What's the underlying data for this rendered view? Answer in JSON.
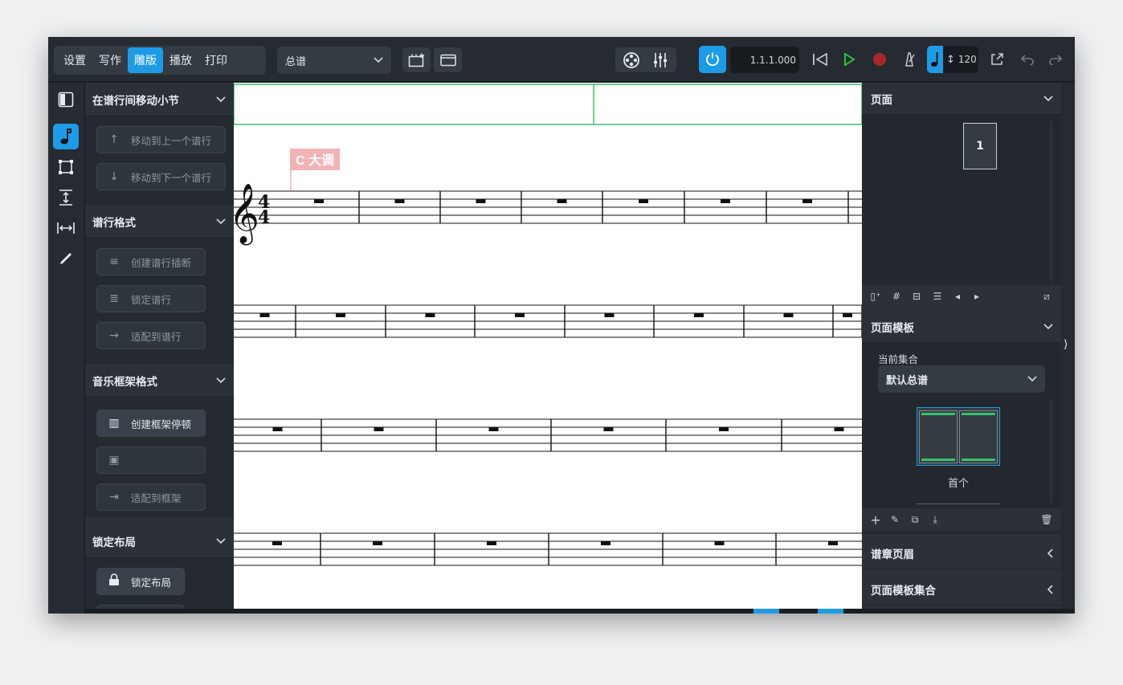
{
  "modes": [
    "设置",
    "写作",
    "雕版",
    "播放",
    "打印"
  ],
  "active_mode": "雕版",
  "layout_select": "总谱",
  "transport": {
    "position": "1.1.1.000",
    "tempo": "120"
  },
  "left_panel": {
    "sections": [
      {
        "title": "在谱行间移动小节",
        "buttons": [
          "移动到上一个谱行",
          "移动到下一个谱行"
        ]
      },
      {
        "title": "谱行格式",
        "buttons": [
          "创建谱行插断",
          "锁定谱行",
          "适配到谱行"
        ]
      },
      {
        "title": "音乐框架格式",
        "buttons": [
          "创建框架停顿",
          "",
          "适配到框架"
        ]
      },
      {
        "title": "锁定布局",
        "buttons": [
          "锁定布局"
        ]
      }
    ]
  },
  "score": {
    "key_signature_label": "C 大调",
    "time_signature_top": "4",
    "time_signature_bottom": "4"
  },
  "right_panel": {
    "pages": {
      "title": "页面",
      "page_number": "1"
    },
    "page_templates": {
      "title": "页面模板",
      "current_set_label": "当前集合",
      "current_set_value": "默认总谱",
      "template_name": "首个"
    },
    "flow_headings": {
      "title": "谱章页眉"
    },
    "page_template_sets": {
      "title": "页面模板集合"
    }
  },
  "colors": {
    "accent": "#1e9be6",
    "play": "#2ecc40",
    "record": "#d0312d",
    "system_frame": "#37c26a",
    "key_label_bg": "#f3b3b6"
  }
}
